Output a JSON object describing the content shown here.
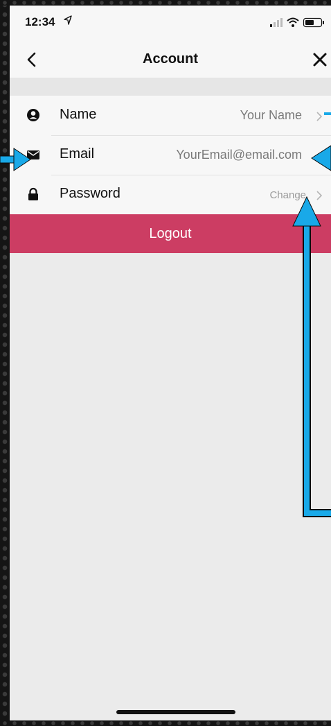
{
  "status_bar": {
    "time": "12:34",
    "location_icon": "location-arrow-icon",
    "signal_icon": "signal-bars-icon",
    "wifi_icon": "wifi-icon",
    "battery_icon": "battery-icon"
  },
  "nav": {
    "back_icon": "chevron-left-icon",
    "title": "Account",
    "close_icon": "close-icon"
  },
  "rows": [
    {
      "icon": "user-circle-icon",
      "label": "Name",
      "value": "Your Name",
      "chevron_icon": "chevron-right-icon"
    },
    {
      "icon": "envelope-icon",
      "label": "Email",
      "value": "YourEmail@email.com"
    },
    {
      "icon": "lock-icon",
      "label": "Password",
      "value": "Change",
      "chevron_icon": "chevron-right-icon"
    }
  ],
  "logout": {
    "label": "Logout"
  },
  "colors": {
    "logout_bg": "#cc3d63",
    "annotation_arrow": "#19a9e8",
    "background": "#ebebeb",
    "list_bg": "#f7f7f7"
  }
}
